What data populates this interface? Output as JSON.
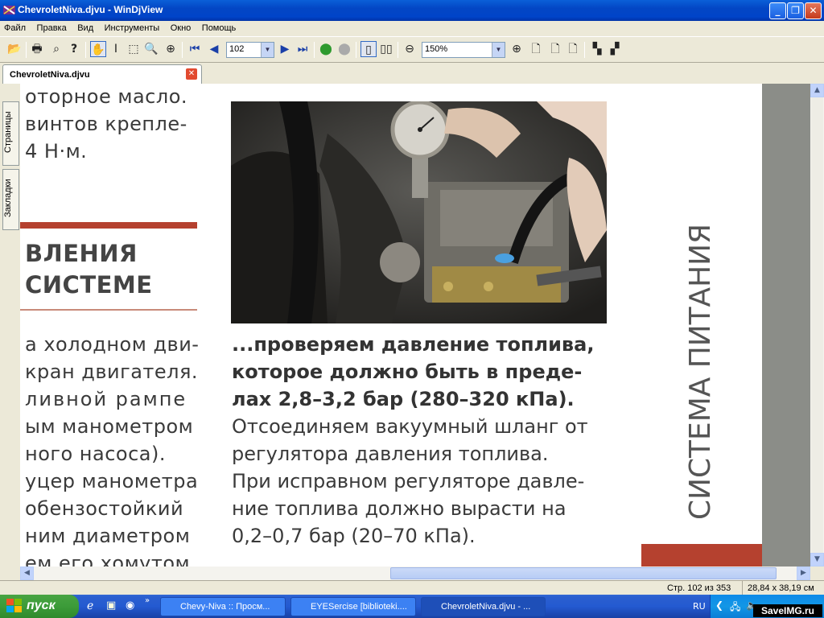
{
  "window": {
    "title": "ChevroletNiva.djvu - WinDjView"
  },
  "menu": [
    "Файл",
    "Правка",
    "Вид",
    "Инструменты",
    "Окно",
    "Помощь"
  ],
  "toolbar": {
    "page_value": "102",
    "zoom_value": "150%"
  },
  "tab": {
    "label": "ChevroletNiva.djvu"
  },
  "sidetabs": {
    "pages": "Страницы",
    "bookmarks": "Закладки"
  },
  "page": {
    "left_col_top": [
      "оторное масло.",
      "винтов крепле-",
      "4 Н·м."
    ],
    "section_heading": [
      "ВЛЕНИЯ",
      "СИСТЕМЕ"
    ],
    "left_col_body": [
      "а холодном дви-",
      "кран двигателя.",
      "ливной рампе",
      "ым манометром",
      "ного насоса).",
      "уцер манометра",
      "обензостойкий",
      "ним диаметром",
      "ем его хомутом."
    ],
    "caption_bold": [
      "...проверяем давление топлива,",
      "которое должно быть в преде-",
      "лах 2,8–3,2 бар (280–320 кПа)."
    ],
    "caption_text": [
      "Отсоединяем вакуумный шланг от",
      "регулятора давления топлива.",
      "При исправном регуляторе давле-",
      "ние топлива должно вырасти на",
      "0,2–0,7 бар (20–70 кПа)."
    ],
    "vertical_title": "СИСТЕМА ПИТАНИЯ",
    "accent_color": "#b5412f"
  },
  "status": {
    "page_info": "Стр. 102 из 353",
    "page_size": "28,84 x 38,19 см"
  },
  "taskbar": {
    "start_label": "пуск",
    "tasks": [
      "Chevy-Niva :: Просм...",
      "EYESercise [biblioteki....",
      "ChevroletNiva.djvu - ..."
    ],
    "lang": "RU",
    "watermark": "SaveIMG.ru"
  }
}
